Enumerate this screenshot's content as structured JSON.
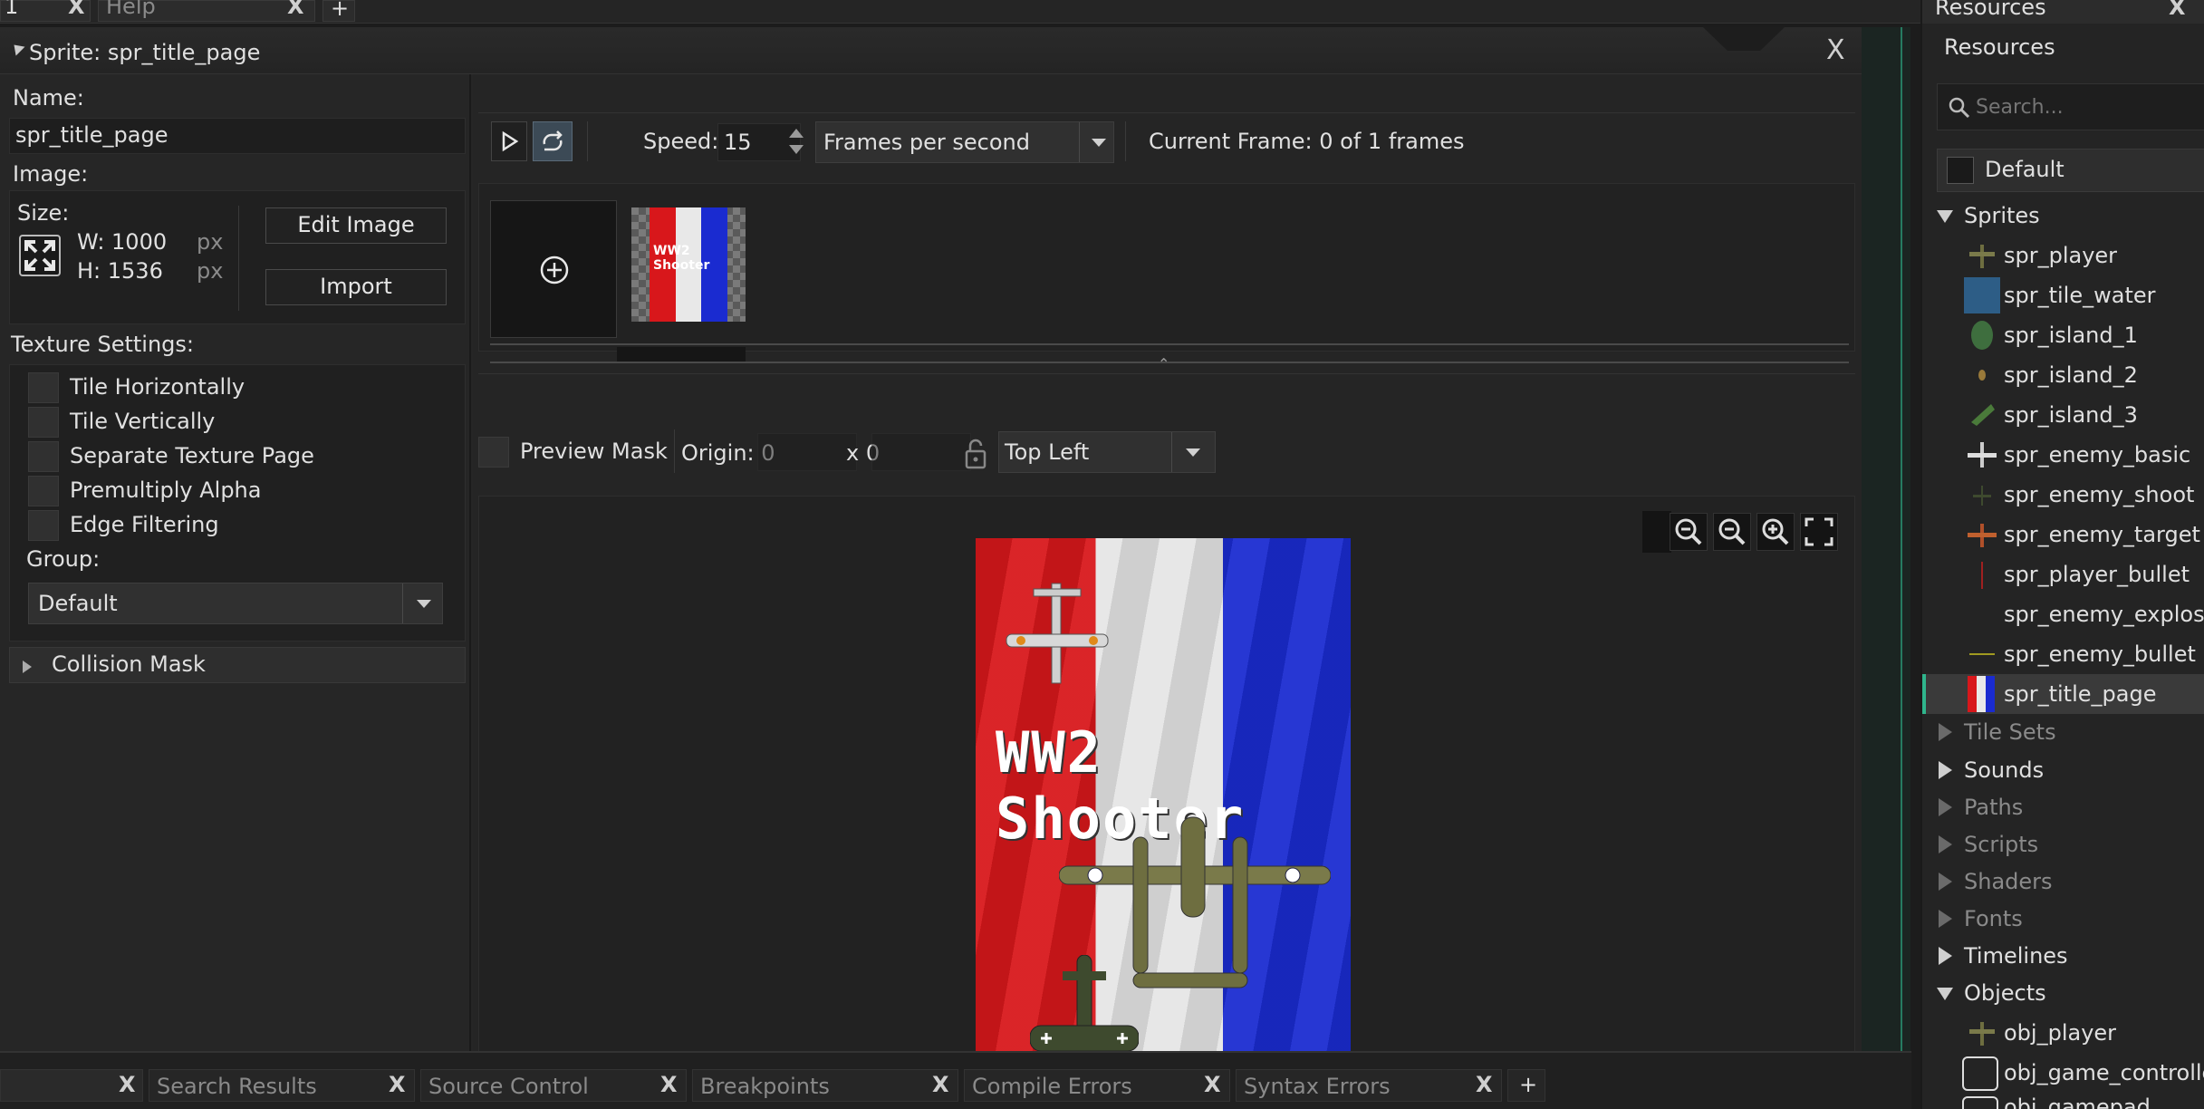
{
  "top_tabs": [
    {
      "label": "1"
    },
    {
      "label": "Help"
    },
    {
      "label": "+"
    }
  ],
  "sprite_window": {
    "title": "Sprite: spr_title_page",
    "close": "X"
  },
  "left_panel": {
    "name_label": "Name:",
    "name_value": "spr_title_page",
    "image_label": "Image:",
    "size_label": "Size:",
    "width_label": "W: 1000",
    "height_label": "H: 1536",
    "unit": "px",
    "edit_image": "Edit Image",
    "import": "Import",
    "texture_settings_label": "Texture Settings:",
    "texture_options": [
      {
        "label": "Tile Horizontally"
      },
      {
        "label": "Tile Vertically"
      },
      {
        "label": "Separate Texture Page"
      },
      {
        "label": "Premultiply Alpha"
      },
      {
        "label": "Edge Filtering"
      }
    ],
    "group_label": "Group:",
    "group_value": "Default",
    "collision_mask": "Collision Mask"
  },
  "playback": {
    "speed_label": "Speed:",
    "speed_value": "15",
    "speed_unit": "Frames per second",
    "current_frame": "Current Frame: 0 of 1 frames"
  },
  "origin_bar": {
    "preview_mask": "Preview Mask",
    "origin_label": "Origin: 0",
    "origin_y": "x 0",
    "origin_preset": "Top Left"
  },
  "preview_image": {
    "title_text": "WW2 Shooter"
  },
  "bottom_tabs": [
    {
      "label": ""
    },
    {
      "label": "Search Results"
    },
    {
      "label": "Source Control"
    },
    {
      "label": "Breakpoints"
    },
    {
      "label": "Compile Errors"
    },
    {
      "label": "Syntax Errors"
    },
    {
      "label": "+"
    }
  ],
  "resources": {
    "tab_label": "Resources",
    "header": "Resources",
    "search_placeholder": "Search...",
    "default_group": "Default",
    "sprites_label": "Sprites",
    "sprites": [
      {
        "label": "spr_player"
      },
      {
        "label": "spr_tile_water"
      },
      {
        "label": "spr_island_1"
      },
      {
        "label": "spr_island_2"
      },
      {
        "label": "spr_island_3"
      },
      {
        "label": "spr_enemy_basic"
      },
      {
        "label": "spr_enemy_shoot"
      },
      {
        "label": "spr_enemy_target"
      },
      {
        "label": "spr_player_bullet"
      },
      {
        "label": "spr_enemy_explosio"
      },
      {
        "label": "spr_enemy_bullet"
      },
      {
        "label": "spr_title_page"
      }
    ],
    "folders": [
      {
        "label": "Tile Sets"
      },
      {
        "label": "Sounds"
      },
      {
        "label": "Paths"
      },
      {
        "label": "Scripts"
      },
      {
        "label": "Shaders"
      },
      {
        "label": "Fonts"
      },
      {
        "label": "Timelines"
      }
    ],
    "objects_label": "Objects",
    "objects": [
      {
        "label": "obj_player"
      },
      {
        "label": "obj_game_controller"
      },
      {
        "label": "obj_gamepad"
      }
    ]
  },
  "colors": {
    "accent_green": "#2fb58c",
    "selected_row": "#3a3a3a",
    "flag_red": "#d8171b",
    "flag_white": "#e8e8e8",
    "flag_blue": "#1a2bd0"
  }
}
